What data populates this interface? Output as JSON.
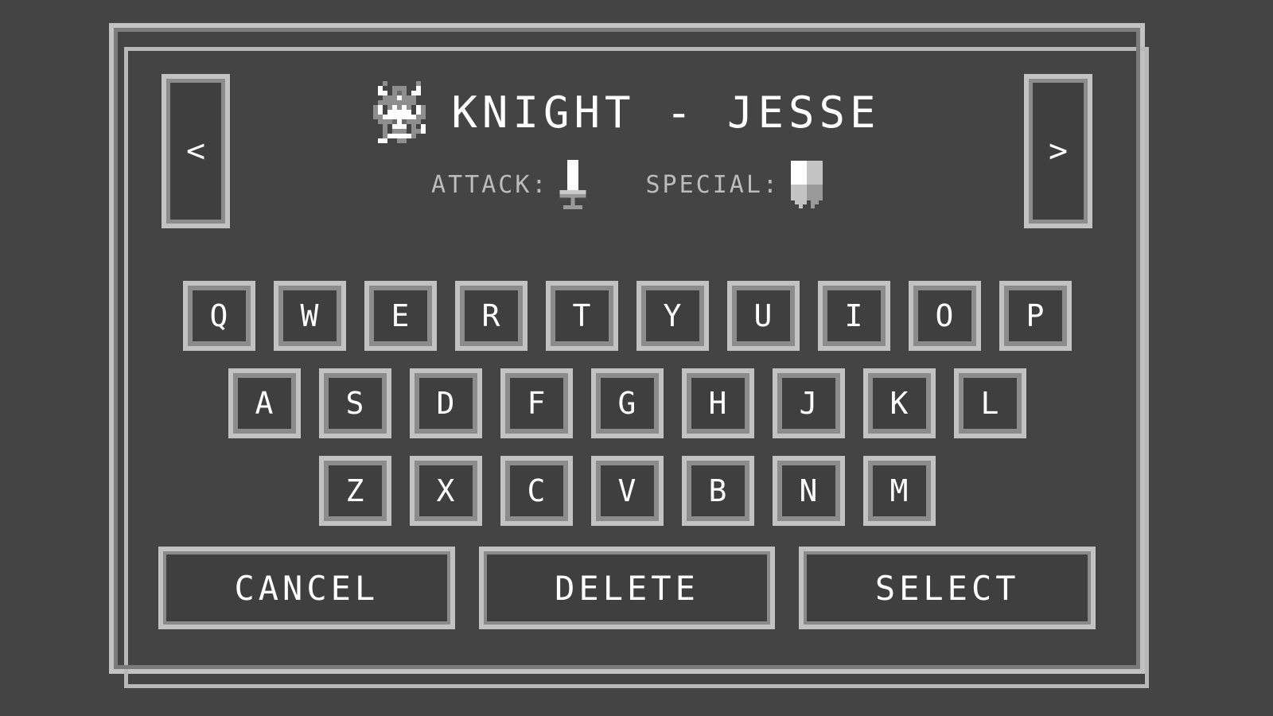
{
  "screen": {
    "name": "character-select-name-entry",
    "background_color": "#444444",
    "frame_color": "#c2c2c2",
    "frame_shadow_color": "#7b7b7b",
    "panel_fill_color": "#3f3f3f",
    "text_color": "#ffffff",
    "muted_text_color": "#bcbcbc"
  },
  "header": {
    "prev_arrow_label": "<",
    "next_arrow_label": ">",
    "character_title": "KNIGHT - JESSE",
    "character_class": "KNIGHT",
    "character_name": "JESSE",
    "sprite_icon": "knight-sprite-icon"
  },
  "stats": [
    {
      "label": "ATTACK:",
      "icon": "sword-icon",
      "value": "sword"
    },
    {
      "label": "SPECIAL:",
      "icon": "shield-icon",
      "value": "shield"
    }
  ],
  "keyboard": {
    "rows": [
      [
        "Q",
        "W",
        "E",
        "R",
        "T",
        "Y",
        "U",
        "I",
        "O",
        "P"
      ],
      [
        "A",
        "S",
        "D",
        "F",
        "G",
        "H",
        "J",
        "K",
        "L"
      ],
      [
        "Z",
        "X",
        "C",
        "V",
        "B",
        "N",
        "M"
      ]
    ]
  },
  "actions": [
    {
      "id": "cancel",
      "label": "CANCEL"
    },
    {
      "id": "delete",
      "label": "DELETE"
    },
    {
      "id": "select",
      "label": "SELECT"
    }
  ],
  "sprites": {
    "knight": {
      "cols": 12,
      "rows": 13,
      "palette": {
        "w": "#ffffff",
        "l": "#bdbdbd",
        "m": "#8e8e8e",
        "d": "#6a6a6a",
        ".": "transparent"
      },
      "pixels": [
        "..m......m..",
        ".w..mmm..w..",
        ".ww.mdm.ww..",
        "..mmmwmmm...",
        ".mmmmmmmm...",
        "mw.mwmwm.wm.",
        "mw.wwwww.wm.",
        "mmwwwwwwwmm.",
        ".mmmdwdmmm..",
        "..m.www.m.w.",
        "..m.mmm.mmw.",
        "..mwwwwwm...",
        ".ww..mm......"
      ]
    },
    "sword": {
      "cols": 7,
      "rows": 13,
      "palette": {
        "w": "#ffffff",
        "l": "#c9c9c9",
        "m": "#9a9a9a",
        ".": "transparent"
      },
      "pixels": [
        "..www..",
        "..www..",
        "..www..",
        "..www..",
        "..www..",
        "..www..",
        "..www..",
        "..www..",
        "lllllll",
        "mmmmmmm",
        "...m...",
        "...m...",
        ".mmmmm."
      ]
    },
    "shield": {
      "cols": 8,
      "rows": 12,
      "palette": {
        "w": "#ffffff",
        "l": "#c4c4c4",
        "m": "#9a9a9a",
        "d": "#767676",
        ".": "transparent"
      },
      "pixels": [
        "wwwwllll",
        "wwwwllll",
        "wwwwllll",
        "wwwwllll",
        "wwwwllll",
        "wwwwllll",
        "llllmmmm",
        "llllmmmm",
        "llllmmmm",
        "llllmmmm",
        ".lll.mm.",
        "..l..m.."
      ]
    }
  }
}
